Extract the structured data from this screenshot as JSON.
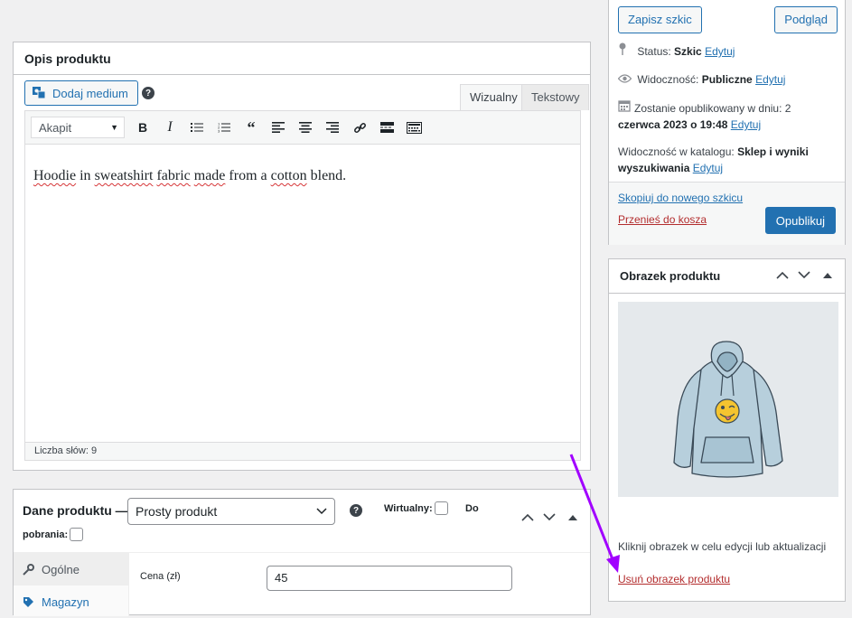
{
  "description_box": {
    "title": "Opis produktu",
    "add_media_label": "Dodaj medium",
    "help_symbol": "?",
    "tabs": {
      "visual": "Wizualny",
      "text": "Tekstowy"
    },
    "format_select": "Akapit",
    "toolbar_icons": [
      "bold-icon",
      "italic-icon",
      "bullet-list-icon",
      "numbered-list-icon",
      "blockquote-icon",
      "align-left-icon",
      "align-center-icon",
      "align-right-icon",
      "link-icon",
      "read-more-icon",
      "toolbar-toggle-icon"
    ],
    "content_words": [
      "Hoodie",
      "in",
      "sweatshirt",
      "fabric",
      "made",
      "from",
      "a",
      "cotton",
      "blend."
    ],
    "word_count": "Liczba słów: 9"
  },
  "product_data": {
    "title": "Dane produktu —",
    "title_cont": "pobrania:",
    "product_type": "Prosty produkt",
    "virtual_label": "Wirtualny:",
    "downloadable_label": "Do",
    "tabs": [
      {
        "label": "Ogólne",
        "icon": "wrench-icon"
      },
      {
        "label": "Magazyn",
        "icon": "tag-icon"
      }
    ],
    "price_label": "Cena (zł)",
    "price_value": "45"
  },
  "publish_box": {
    "save_draft": "Zapisz szkic",
    "preview": "Podgląd",
    "status_label": "Status:",
    "status_value": "Szkic",
    "visibility_label": "Widoczność:",
    "visibility_value": "Publiczne",
    "schedule_label": "Zostanie opublikowany w dniu: 2",
    "schedule_value": "czerwca 2023 o 19:48",
    "catalog_label": "Widoczność w katalogu:",
    "catalog_value_1": "Sklep i wyniki",
    "catalog_value_2": "wyszukiwania",
    "edit_link": "Edytuj",
    "copy_link": "Skopiuj do nowego szkicu",
    "trash_link": "Przenieś do kosza",
    "publish_button": "Opublikuj"
  },
  "image_box": {
    "title": "Obrazek produktu",
    "hint": "Kliknij obrazek w celu edycji lub aktualizacji",
    "remove_link": "Usuń obrazek produktu"
  },
  "annotation": {
    "arrow_color": "#a100ff"
  },
  "colors": {
    "accent": "#2271b1",
    "danger": "#b32d2e"
  }
}
